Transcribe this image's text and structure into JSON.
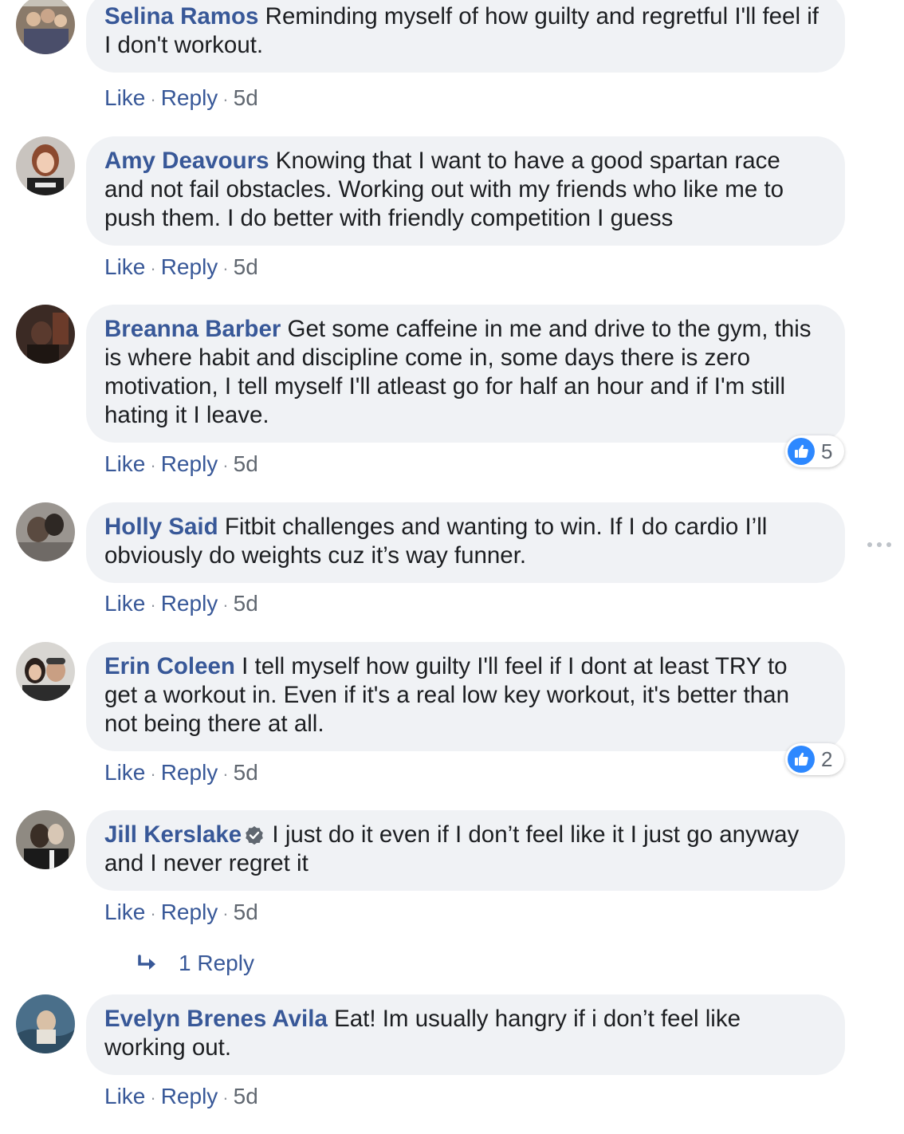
{
  "comments": [
    {
      "author": "Selina Ramos",
      "text": "Reminding myself of how guilty and regretful I'll feel if I don't workout.",
      "like_label": "Like",
      "reply_label": "Reply",
      "time": "5d"
    },
    {
      "author": "Amy Deavours",
      "text": "Knowing that I want to have a good spartan race and not fail obstacles. Working out with my friends who like me to push them. I do better with friendly competition I guess",
      "like_label": "Like",
      "reply_label": "Reply",
      "time": "5d"
    },
    {
      "author": "Breanna Barber",
      "text": "Get some caffeine in me and drive to the gym, this is where habit and discipline come in, some days there is zero motivation, I tell myself I'll atleast go for half an hour and if I'm still hating it I leave.",
      "like_label": "Like",
      "reply_label": "Reply",
      "time": "5d",
      "reaction_count": "5"
    },
    {
      "author": "Holly Said",
      "text": "Fitbit challenges and wanting to win. If I do cardio I’ll obviously do weights cuz it’s way funner.",
      "like_label": "Like",
      "reply_label": "Reply",
      "time": "5d"
    },
    {
      "author": "Erin Coleen",
      "text": "I tell myself how guilty I'll feel if I dont at least TRY to get a workout in. Even if it's a real low key workout, it's better than not being there at all.",
      "like_label": "Like",
      "reply_label": "Reply",
      "time": "5d",
      "reaction_count": "2"
    },
    {
      "author": "Jill Kerslake",
      "text": "I just do it even if I don’t feel like it I just go anyway and I never regret it",
      "like_label": "Like",
      "reply_label": "Reply",
      "time": "5d",
      "replies_label": "1 Reply"
    },
    {
      "author": "Evelyn Brenes Avila",
      "text": "Eat! Im usually hangry if i don’t feel like working out.",
      "like_label": "Like",
      "reply_label": "Reply",
      "time": "5d"
    }
  ],
  "colors": {
    "author": "#385898",
    "bubble": "#f0f2f5",
    "like_badge": "#2d88ff",
    "meta": "#606770"
  },
  "icons": {
    "more": "more-options-icon",
    "like": "thumbs-up-icon",
    "verified": "verified-badge-icon",
    "reply_arrow": "reply-arrow-icon"
  }
}
